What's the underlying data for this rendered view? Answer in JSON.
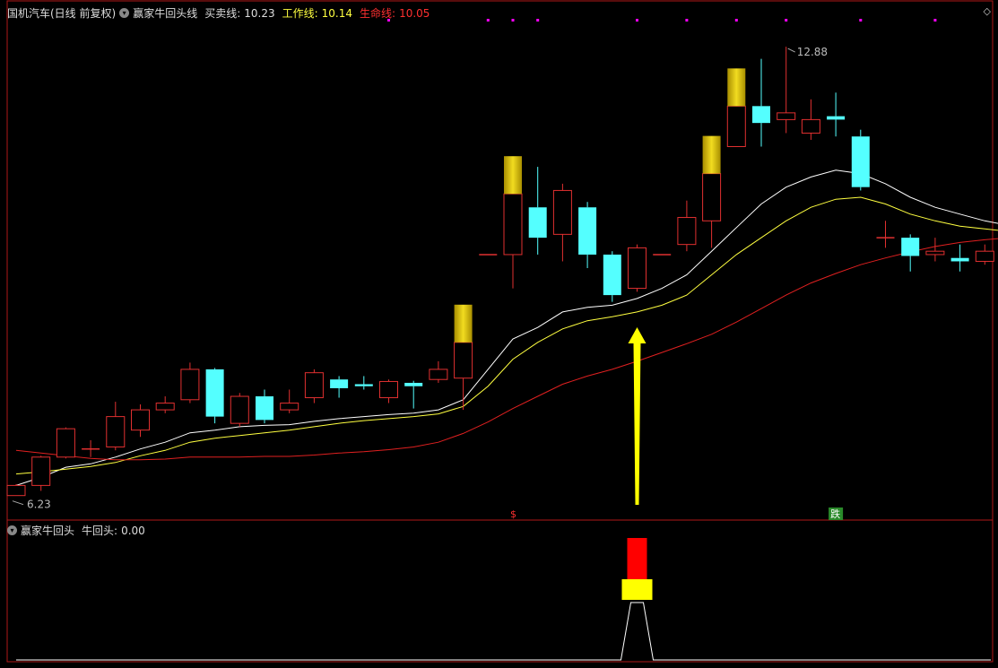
{
  "header_main": {
    "stock": "国机汽车(日线 前复权)",
    "indicator": "赢家牛回头线",
    "buy_sell_label": "买卖线:",
    "buy_sell_value": "10.23",
    "work_label": "工作线:",
    "work_value": "10.14",
    "life_label": "生命线:",
    "life_value": "10.05"
  },
  "header_sub": {
    "indicator": "赢家牛回头",
    "label": "牛回头:",
    "value": "0.00"
  },
  "colors": {
    "up": "#e03030",
    "down": "#54ffff",
    "gold": "#d4b800",
    "white_line": "#ffffff",
    "yellow_line": "#ffff40",
    "red_line": "#e02020",
    "border": "#b01818",
    "arrow": "#ffff00",
    "magenta": "#ff00ff"
  },
  "chart_data": [
    {
      "type": "candlestick",
      "price_range": [
        6.0,
        13.2
      ],
      "high_label": "12.88",
      "low_label": "6.23",
      "marker_low_text": "$",
      "marker_high_text": "跌",
      "candles": [
        {
          "o": 6.23,
          "c": 6.38,
          "h": 6.4,
          "l": 6.23,
          "gold": false
        },
        {
          "o": 6.38,
          "c": 6.8,
          "h": 6.82,
          "l": 6.3,
          "gold": false
        },
        {
          "o": 6.8,
          "c": 7.22,
          "h": 7.24,
          "l": 6.78,
          "gold": false
        },
        {
          "o": 6.92,
          "c": 6.92,
          "h": 7.05,
          "l": 6.8,
          "gold": false
        },
        {
          "o": 6.95,
          "c": 7.4,
          "h": 7.62,
          "l": 6.9,
          "gold": false
        },
        {
          "o": 7.2,
          "c": 7.5,
          "h": 7.58,
          "l": 7.1,
          "gold": false
        },
        {
          "o": 7.5,
          "c": 7.6,
          "h": 7.7,
          "l": 7.45,
          "gold": false
        },
        {
          "o": 7.65,
          "c": 8.1,
          "h": 8.2,
          "l": 7.6,
          "gold": false
        },
        {
          "o": 8.1,
          "c": 7.4,
          "h": 8.12,
          "l": 7.3,
          "gold": false
        },
        {
          "o": 7.3,
          "c": 7.7,
          "h": 7.75,
          "l": 7.25,
          "gold": false
        },
        {
          "o": 7.7,
          "c": 7.35,
          "h": 7.8,
          "l": 7.3,
          "gold": false
        },
        {
          "o": 7.5,
          "c": 7.6,
          "h": 7.8,
          "l": 7.45,
          "gold": false
        },
        {
          "o": 7.68,
          "c": 8.05,
          "h": 8.1,
          "l": 7.6,
          "gold": false
        },
        {
          "o": 7.95,
          "c": 7.82,
          "h": 8.0,
          "l": 7.68,
          "gold": false
        },
        {
          "o": 7.88,
          "c": 7.85,
          "h": 8.0,
          "l": 7.8,
          "gold": false
        },
        {
          "o": 7.68,
          "c": 7.92,
          "h": 7.95,
          "l": 7.6,
          "gold": false
        },
        {
          "o": 7.9,
          "c": 7.85,
          "h": 7.93,
          "l": 7.52,
          "gold": false
        },
        {
          "o": 7.95,
          "c": 8.1,
          "h": 8.22,
          "l": 7.9,
          "gold": false
        },
        {
          "o": 7.97,
          "c": 8.5,
          "h": 8.55,
          "l": 7.5,
          "gold": true
        },
        {
          "o": 9.8,
          "c": 9.8,
          "h": 9.8,
          "l": 9.8,
          "gold": false
        },
        {
          "o": 9.8,
          "c": 10.7,
          "h": 10.7,
          "l": 9.3,
          "gold": true
        },
        {
          "o": 10.5,
          "c": 10.05,
          "h": 11.1,
          "l": 9.8,
          "gold": false
        },
        {
          "o": 10.1,
          "c": 10.75,
          "h": 10.85,
          "l": 9.7,
          "gold": false
        },
        {
          "o": 10.5,
          "c": 9.8,
          "h": 10.58,
          "l": 9.6,
          "gold": false
        },
        {
          "o": 9.8,
          "c": 9.2,
          "h": 9.85,
          "l": 9.1,
          "gold": false
        },
        {
          "o": 9.3,
          "c": 9.9,
          "h": 9.95,
          "l": 9.25,
          "gold": false
        },
        {
          "o": 9.8,
          "c": 9.8,
          "h": 9.8,
          "l": 9.8,
          "gold": false
        },
        {
          "o": 9.95,
          "c": 10.35,
          "h": 10.6,
          "l": 9.85,
          "gold": false
        },
        {
          "o": 10.3,
          "c": 11.0,
          "h": 11.0,
          "l": 9.9,
          "gold": true
        },
        {
          "o": 11.4,
          "c": 12.0,
          "h": 12.0,
          "l": 11.4,
          "gold": true
        },
        {
          "o": 12.0,
          "c": 11.75,
          "h": 12.7,
          "l": 11.4,
          "gold": false
        },
        {
          "o": 11.8,
          "c": 11.9,
          "h": 12.88,
          "l": 11.6,
          "gold": false
        },
        {
          "o": 11.6,
          "c": 11.8,
          "h": 12.1,
          "l": 11.5,
          "gold": false
        },
        {
          "o": 11.85,
          "c": 11.8,
          "h": 12.2,
          "l": 11.55,
          "gold": false
        },
        {
          "o": 11.55,
          "c": 10.8,
          "h": 11.65,
          "l": 10.75,
          "gold": false
        },
        {
          "o": 10.05,
          "c": 10.05,
          "h": 10.3,
          "l": 9.9,
          "gold": false
        },
        {
          "o": 10.05,
          "c": 9.78,
          "h": 10.1,
          "l": 9.55,
          "gold": false
        },
        {
          "o": 9.8,
          "c": 9.85,
          "h": 10.05,
          "l": 9.7,
          "gold": false
        },
        {
          "o": 9.75,
          "c": 9.7,
          "h": 9.95,
          "l": 9.55,
          "gold": false
        },
        {
          "o": 9.7,
          "c": 9.85,
          "h": 9.95,
          "l": 9.65,
          "gold": false
        },
        {
          "o": 9.7,
          "c": 10.15,
          "h": 10.3,
          "l": 9.68,
          "gold": false
        }
      ],
      "series": [
        {
          "name": "买卖线",
          "values": [
            6.38,
            6.5,
            6.65,
            6.7,
            6.8,
            6.92,
            7.02,
            7.16,
            7.2,
            7.25,
            7.27,
            7.28,
            7.33,
            7.37,
            7.4,
            7.43,
            7.45,
            7.5,
            7.65,
            8.1,
            8.55,
            8.72,
            8.95,
            9.02,
            9.05,
            9.15,
            9.3,
            9.5,
            9.85,
            10.2,
            10.55,
            10.8,
            10.95,
            11.05,
            11.0,
            10.85,
            10.65,
            10.5,
            10.4,
            10.3,
            10.23
          ]
        },
        {
          "name": "工作线",
          "values": [
            6.55,
            6.58,
            6.62,
            6.66,
            6.72,
            6.82,
            6.9,
            7.02,
            7.08,
            7.12,
            7.16,
            7.2,
            7.25,
            7.3,
            7.34,
            7.37,
            7.4,
            7.44,
            7.55,
            7.85,
            8.25,
            8.5,
            8.7,
            8.82,
            8.88,
            8.95,
            9.05,
            9.2,
            9.5,
            9.8,
            10.05,
            10.3,
            10.5,
            10.62,
            10.65,
            10.55,
            10.4,
            10.3,
            10.22,
            10.18,
            10.14
          ]
        },
        {
          "name": "生命线",
          "values": [
            6.9,
            6.86,
            6.82,
            6.78,
            6.76,
            6.76,
            6.77,
            6.8,
            6.8,
            6.8,
            6.81,
            6.81,
            6.83,
            6.86,
            6.88,
            6.91,
            6.95,
            7.02,
            7.15,
            7.32,
            7.52,
            7.7,
            7.88,
            8.0,
            8.1,
            8.22,
            8.35,
            8.48,
            8.62,
            8.8,
            9.0,
            9.2,
            9.38,
            9.52,
            9.65,
            9.75,
            9.84,
            9.92,
            9.98,
            10.02,
            10.05
          ]
        }
      ]
    },
    {
      "type": "bar",
      "indicator_index": 25,
      "indicator_values": [
        0,
        0,
        0,
        0,
        0,
        0,
        0,
        0,
        0,
        0,
        0,
        0,
        0,
        0,
        0,
        0,
        0,
        0,
        0,
        0,
        0,
        0,
        0,
        0,
        0,
        1,
        0,
        0,
        0,
        0,
        0,
        0,
        0,
        0,
        0,
        0,
        0,
        0,
        0,
        0,
        0
      ]
    }
  ]
}
